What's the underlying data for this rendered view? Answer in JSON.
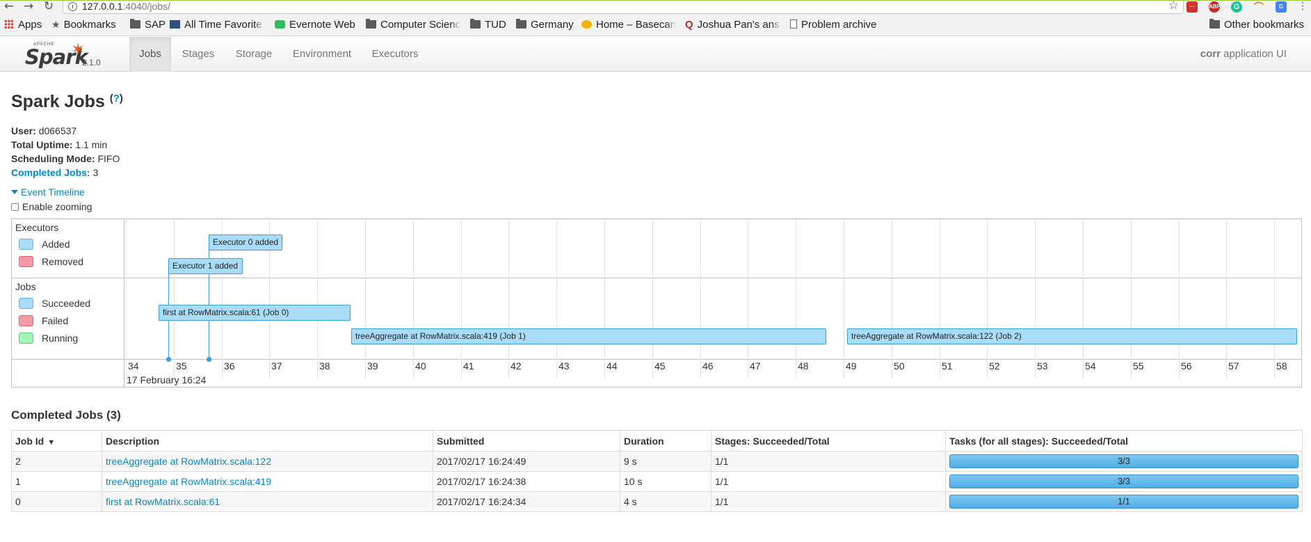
{
  "browser": {
    "url_host": "127.0.0.1",
    "url_rest": ":4040/jobs/",
    "bookmarks": [
      {
        "label": "Apps",
        "icon": "apps-grid-icon"
      },
      {
        "label": "Bookmarks",
        "icon": "star-icon"
      },
      {
        "label": "SAP",
        "icon": "folder-icon"
      },
      {
        "label": "All Time Favorite",
        "icon": "site-favicon"
      },
      {
        "label": "Evernote Web",
        "icon": "evernote-icon"
      },
      {
        "label": "Computer Scienc",
        "icon": "folder-icon"
      },
      {
        "label": "TUD",
        "icon": "folder-icon"
      },
      {
        "label": "Germany",
        "icon": "folder-icon"
      },
      {
        "label": "Home – Basecam",
        "icon": "basecamp-icon"
      },
      {
        "label": "Joshua Pan's ans",
        "icon": "quora-icon"
      },
      {
        "label": "Problem archive",
        "icon": "page-icon"
      }
    ],
    "other_bookmarks": "Other bookmarks",
    "extensions": [
      "ABP"
    ]
  },
  "navbar": {
    "logo_apache": "APACHE",
    "logo_spark": "Spark",
    "version": "2.1.0",
    "tabs": [
      {
        "label": "Jobs",
        "active": true
      },
      {
        "label": "Stages",
        "active": false
      },
      {
        "label": "Storage",
        "active": false
      },
      {
        "label": "Environment",
        "active": false
      },
      {
        "label": "Executors",
        "active": false
      }
    ],
    "app_name": "corr",
    "app_suffix": "application UI"
  },
  "page": {
    "title": "Spark Jobs",
    "help": "?",
    "user_label": "User:",
    "user": "d066537",
    "uptime_label": "Total Uptime:",
    "uptime": "1.1 min",
    "scheduling_label": "Scheduling Mode:",
    "scheduling": "FIFO",
    "completed_label": "Completed Jobs:",
    "completed": "3",
    "timeline_toggle": "Event Timeline",
    "enable_zooming": "Enable zooming"
  },
  "timeline": {
    "executors_title": "Executors",
    "jobs_title": "Jobs",
    "legend_added": "Added",
    "legend_removed": "Removed",
    "legend_succeeded": "Succeeded",
    "legend_failed": "Failed",
    "legend_running": "Running",
    "executor_events": [
      "Executor 0 added",
      "Executor 1 added"
    ],
    "job_bars": [
      "first at RowMatrix.scala:61 (Job 0)",
      "treeAggregate at RowMatrix.scala:419 (Job 1)",
      "treeAggregate at RowMatrix.scala:122 (Job 2)"
    ],
    "ticks": [
      "34",
      "35",
      "36",
      "37",
      "38",
      "39",
      "40",
      "41",
      "42",
      "43",
      "44",
      "45",
      "46",
      "47",
      "48",
      "49",
      "50",
      "51",
      "52",
      "53",
      "54",
      "55",
      "56",
      "57",
      "58"
    ],
    "date_label": "17 February 16:24"
  },
  "jobs_table": {
    "title": "Completed Jobs (3)",
    "headers": {
      "job_id": "Job Id",
      "sort": "▼",
      "description": "Description",
      "submitted": "Submitted",
      "duration": "Duration",
      "stages": "Stages: Succeeded/Total",
      "tasks": "Tasks (for all stages): Succeeded/Total"
    },
    "rows": [
      {
        "id": "2",
        "description": "treeAggregate at RowMatrix.scala:122",
        "submitted": "2017/02/17 16:24:49",
        "duration": "9 s",
        "stages": "1/1",
        "tasks": "3/3",
        "progress": 1.0
      },
      {
        "id": "1",
        "description": "treeAggregate at RowMatrix.scala:419",
        "submitted": "2017/02/17 16:24:38",
        "duration": "10 s",
        "stages": "1/1",
        "tasks": "3/3",
        "progress": 1.0
      },
      {
        "id": "0",
        "description": "first at RowMatrix.scala:61",
        "submitted": "2017/02/17 16:24:34",
        "duration": "4 s",
        "stages": "1/1",
        "tasks": "1/1",
        "progress": 1.0
      }
    ]
  }
}
